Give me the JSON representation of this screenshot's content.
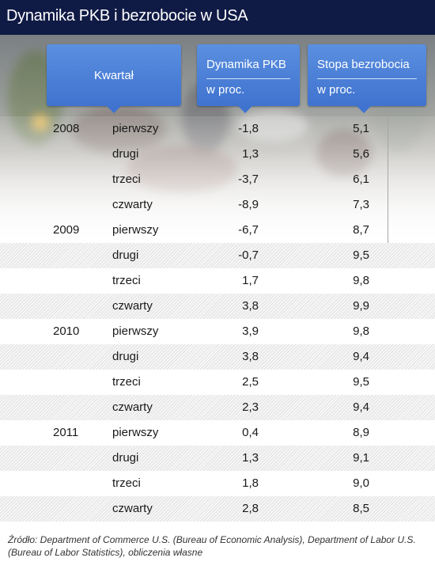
{
  "title": "Dynamika PKB i bezrobocie w USA",
  "headers": {
    "quarter": "Kwartał",
    "pkb_line1": "Dynamika PKB",
    "pkb_line2": "w proc.",
    "unemp_line1": "Stopa bezrobocia",
    "unemp_line2": "w proc."
  },
  "rows": [
    {
      "year": "2008",
      "quarter": "pierwszy",
      "pkb": "-1,8",
      "unemp": "5,1"
    },
    {
      "year": "",
      "quarter": "drugi",
      "pkb": "1,3",
      "unemp": "5,6"
    },
    {
      "year": "",
      "quarter": "trzeci",
      "pkb": "-3,7",
      "unemp": "6,1"
    },
    {
      "year": "",
      "quarter": "czwarty",
      "pkb": "-8,9",
      "unemp": "7,3"
    },
    {
      "year": "2009",
      "quarter": "pierwszy",
      "pkb": "-6,7",
      "unemp": "8,7"
    },
    {
      "year": "",
      "quarter": "drugi",
      "pkb": "-0,7",
      "unemp": "9,5"
    },
    {
      "year": "",
      "quarter": "trzeci",
      "pkb": "1,7",
      "unemp": "9,8"
    },
    {
      "year": "",
      "quarter": "czwarty",
      "pkb": "3,8",
      "unemp": "9,9"
    },
    {
      "year": "2010",
      "quarter": "pierwszy",
      "pkb": "3,9",
      "unemp": "9,8"
    },
    {
      "year": "",
      "quarter": "drugi",
      "pkb": "3,8",
      "unemp": "9,4"
    },
    {
      "year": "",
      "quarter": "trzeci",
      "pkb": "2,5",
      "unemp": "9,5"
    },
    {
      "year": "",
      "quarter": "czwarty",
      "pkb": "2,3",
      "unemp": "9,4"
    },
    {
      "year": "2011",
      "quarter": "pierwszy",
      "pkb": "0,4",
      "unemp": "8,9"
    },
    {
      "year": "",
      "quarter": "drugi",
      "pkb": "1,3",
      "unemp": "9,1"
    },
    {
      "year": "",
      "quarter": "trzeci",
      "pkb": "1,8",
      "unemp": "9,0"
    },
    {
      "year": "",
      "quarter": "czwarty",
      "pkb": "2,8",
      "unemp": "8,5"
    }
  ],
  "footer": "Źródło: Department of Commerce U.S. (Bureau of Economic Analysis), Department of Labor U.S. (Bureau of Labor Statistics), obliczenia własne",
  "colors": {
    "title_bar": "#0f1a45",
    "header_blue": "#4a80d8"
  }
}
